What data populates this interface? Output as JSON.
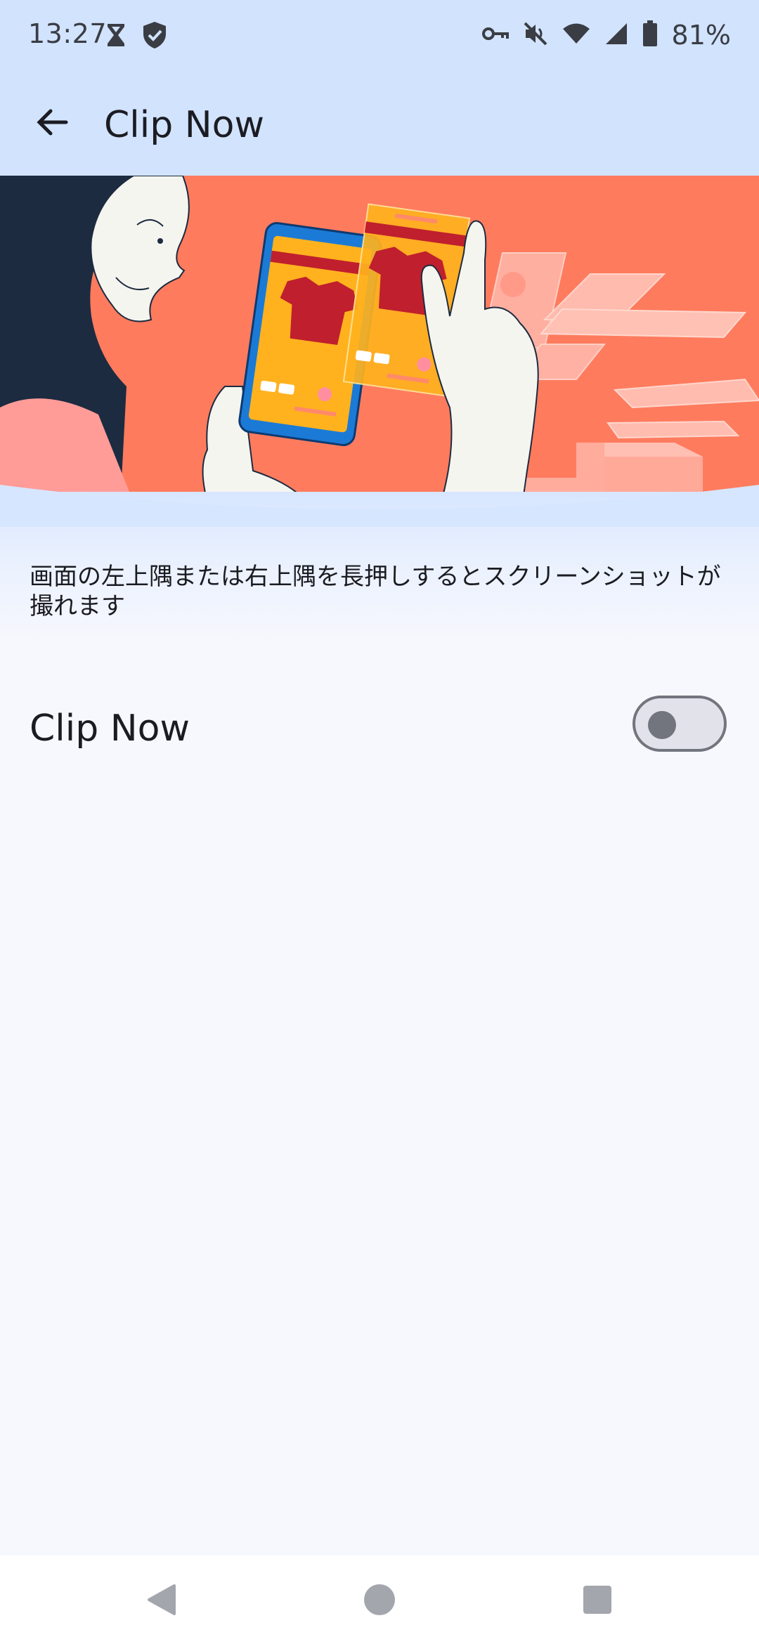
{
  "status_bar": {
    "time": "13:27",
    "battery_percent": "81%",
    "icons": [
      "hourglass-icon",
      "shield-check-icon",
      "vpn-key-icon",
      "mute-icon",
      "wifi-icon",
      "signal-icon",
      "battery-icon"
    ]
  },
  "app_bar": {
    "title": "Clip Now",
    "back_icon": "arrow-back-icon"
  },
  "hero": {
    "illustration": "person-using-phone-screenshot-illustration",
    "colors": {
      "background": "#ff7b5e",
      "hair": "#1c2b40",
      "phone": "#1b7ad6",
      "screen": "#ffb21e",
      "shirt": "#c01f2d"
    }
  },
  "description": "画面の左上隅または右上隅を長押しするとスクリーンショットが撮れます",
  "setting": {
    "label": "Clip Now",
    "enabled": false
  },
  "nav_bar": {
    "buttons": [
      "back-triangle-icon",
      "home-circle-icon",
      "recents-square-icon"
    ]
  },
  "colors": {
    "header_bg": "#d2e3fe",
    "page_bg": "#f7f8fd",
    "toggle_off": "#72757d"
  }
}
